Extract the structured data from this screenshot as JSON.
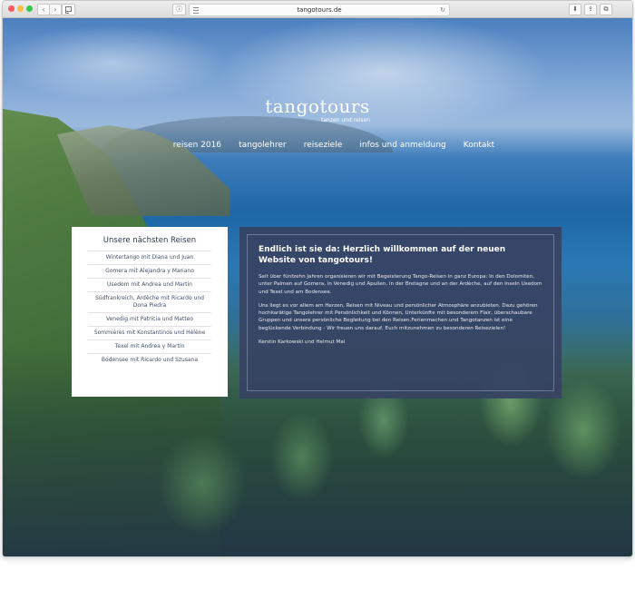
{
  "browser": {
    "url": "tangotours.de",
    "back_label": "‹",
    "forward_label": "›",
    "reload_label": "↻",
    "download_label": "⬇",
    "share_label": "⇪",
    "tabs_label": "⧉",
    "ext_label": "ⓘ"
  },
  "header": {
    "logo": "tangotours",
    "logo_tagline": "tanzen und reisen",
    "nav": [
      {
        "label": "reisen 2016"
      },
      {
        "label": "tangolehrer"
      },
      {
        "label": "reiseziele"
      },
      {
        "label": "infos und anmeldung"
      },
      {
        "label": "Kontakt"
      }
    ]
  },
  "reisen": {
    "title": "Unsere nächsten Reisen",
    "items": [
      "Wintertango mit Diana und Juan",
      "Gomera mit Alejandra y Mariano",
      "Usedom mit Andrea und Martin",
      "Südfrankreich, Ardèche mit Ricardo und Dona Piedra",
      "Venedig mit Patricia und Matteo",
      "Sommières mit Konstantinos und Hélène",
      "Texel mit Andrea y Martín",
      "Bodensee mit Ricardo und Szusana"
    ]
  },
  "welcome": {
    "title": "Endlich ist sie da: Herzlich willkommen auf der neuen Website von tangotours!",
    "paragraphs": [
      "Seit über fünfzehn Jahren organisieren wir mit Begeisterung Tango-Reisen in ganz Europa: In den Dolomiten, unter Palmen auf Gomera, in Venedig und Apulien, in der Bretagne und an der Ardèche, auf den Inseln Usedom und Texel und am Bodensee.",
      "Uns liegt es vor allem am Herzen, Reisen mit Niveau und persönlicher Atmosphäre anzubieten. Dazu gehören hochkarätige Tangolehrer mit Persönlichkeit und Können, Unterkünfte mit besonderem Flair, überschaubare Gruppen und unsere persönliche Begleitung bei den Reisen.Ferienmachen und Tangotanzen ist eine beglückende Verbindung - Wir freuen uns darauf, Euch mitzunehmen zu besonderen Reisezielen!",
      "Kerstin Karkowski und Helmut Mai"
    ]
  }
}
